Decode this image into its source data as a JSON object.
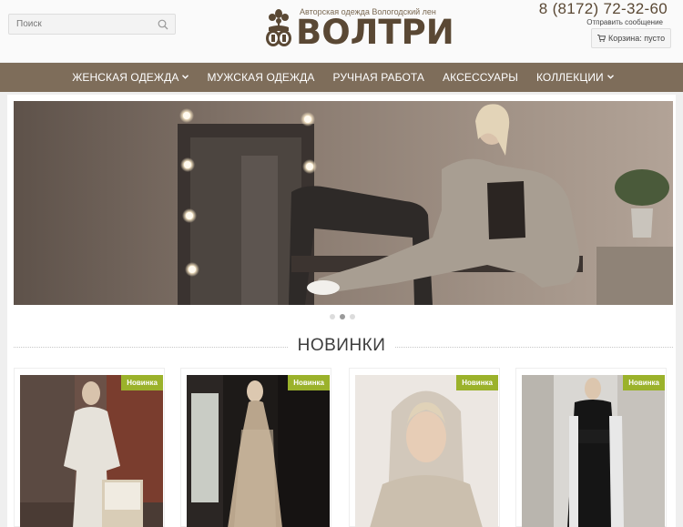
{
  "header": {
    "search_placeholder": "Поиск",
    "tagline": "Авторская одежда Вологодский лен",
    "brand": "ВОЛТРИ",
    "phone": "8 (8172) 72-32-60",
    "send_message": "Отправить сообщение",
    "cart_label": "Корзина: пусто"
  },
  "nav": {
    "items": [
      {
        "label": "ЖЕНСКАЯ ОДЕЖДА",
        "has_dropdown": true
      },
      {
        "label": "МУЖСКАЯ ОДЕЖДА",
        "has_dropdown": false
      },
      {
        "label": "РУЧНАЯ РАБОТА",
        "has_dropdown": false
      },
      {
        "label": "АКСЕССУАРЫ",
        "has_dropdown": false
      },
      {
        "label": "КОЛЛЕКЦИИ",
        "has_dropdown": true
      }
    ]
  },
  "slider": {
    "slide_count": 3,
    "active_index": 1
  },
  "new_section": {
    "title": "НОВИНКИ"
  },
  "products": [
    {
      "badge": "Новинка"
    },
    {
      "badge": "Новинка"
    },
    {
      "badge": "Новинка"
    },
    {
      "badge": "Новинка"
    }
  ],
  "colors": {
    "nav_bg": "#7e6d5a",
    "brand": "#5a4834",
    "badge": "#9bb22b"
  }
}
